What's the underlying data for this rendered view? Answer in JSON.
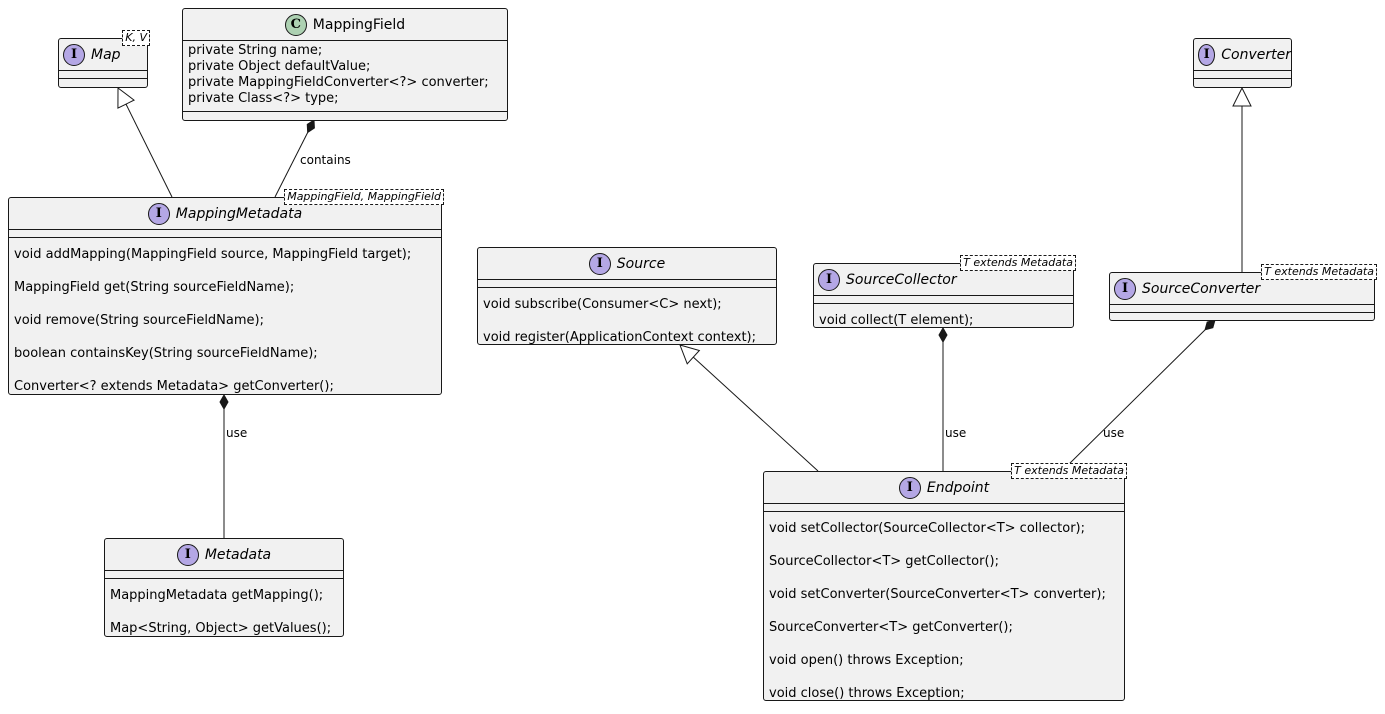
{
  "classes": [
    {
      "id": "map",
      "name": "Map",
      "kind": "I",
      "italic": true,
      "generic": "K, V",
      "attributes": [],
      "methods": []
    },
    {
      "id": "mapping-field",
      "name": "MappingField",
      "kind": "C",
      "italic": false,
      "generic": "",
      "attributes": [
        "private String name;",
        "private Object defaultValue;",
        "private MappingFieldConverter<?> converter;",
        "private Class<?> type;"
      ],
      "methods": []
    },
    {
      "id": "mapping-metadata",
      "name": "MappingMetadata",
      "kind": "I",
      "italic": true,
      "generic": "MappingField, MappingField",
      "attributes": [],
      "methods": [
        "void addMapping(MappingField source, MappingField target);",
        "MappingField get(String sourceFieldName);",
        "void remove(String sourceFieldName);",
        "boolean containsKey(String sourceFieldName);",
        "Converter<? extends Metadata> getConverter();"
      ]
    },
    {
      "id": "metadata",
      "name": "Metadata",
      "kind": "I",
      "italic": true,
      "generic": "",
      "attributes": [],
      "methods": [
        "MappingMetadata getMapping();",
        "Map<String, Object> getValues();"
      ]
    },
    {
      "id": "source",
      "name": "Source",
      "kind": "I",
      "italic": true,
      "generic": "",
      "attributes": [],
      "methods": [
        "void subscribe(Consumer<C> next);",
        "void register(ApplicationContext context);"
      ]
    },
    {
      "id": "source-collector",
      "name": "SourceCollector",
      "kind": "I",
      "italic": true,
      "generic": "T extends Metadata",
      "attributes": [],
      "methods": [
        "void collect(T element);"
      ]
    },
    {
      "id": "converter",
      "name": "Converter",
      "kind": "I",
      "italic": true,
      "generic": "",
      "attributes": [],
      "methods": []
    },
    {
      "id": "source-converter",
      "name": "SourceConverter",
      "kind": "I",
      "italic": true,
      "generic": "T extends Metadata",
      "attributes": [],
      "methods": []
    },
    {
      "id": "endpoint",
      "name": "Endpoint",
      "kind": "I",
      "italic": true,
      "generic": "T extends Metadata",
      "attributes": [],
      "methods": [
        "void setCollector(SourceCollector<T> collector);",
        "SourceCollector<T> getCollector();",
        "void setConverter(SourceConverter<T> converter);",
        "SourceConverter<T> getConverter();",
        "void open() throws Exception;",
        "void close() throws Exception;"
      ]
    }
  ],
  "relations": [
    {
      "from": "mapping-metadata",
      "to": "map",
      "type": "inheritance",
      "label": ""
    },
    {
      "from": "mapping-metadata",
      "to": "mapping-field",
      "type": "composition",
      "label": "contains"
    },
    {
      "from": "metadata",
      "to": "mapping-metadata",
      "type": "composition",
      "label": "use"
    },
    {
      "from": "endpoint",
      "to": "source",
      "type": "inheritance",
      "label": ""
    },
    {
      "from": "endpoint",
      "to": "source-collector",
      "type": "composition",
      "label": "use"
    },
    {
      "from": "source-converter",
      "to": "converter",
      "type": "inheritance",
      "label": ""
    },
    {
      "from": "endpoint",
      "to": "source-converter",
      "type": "composition",
      "label": "use"
    }
  ],
  "colors": {
    "interface_badge": "#b4a7e5",
    "class_badge": "#add1b2",
    "box_fill": "#f1f1f1",
    "line": "#181818"
  }
}
